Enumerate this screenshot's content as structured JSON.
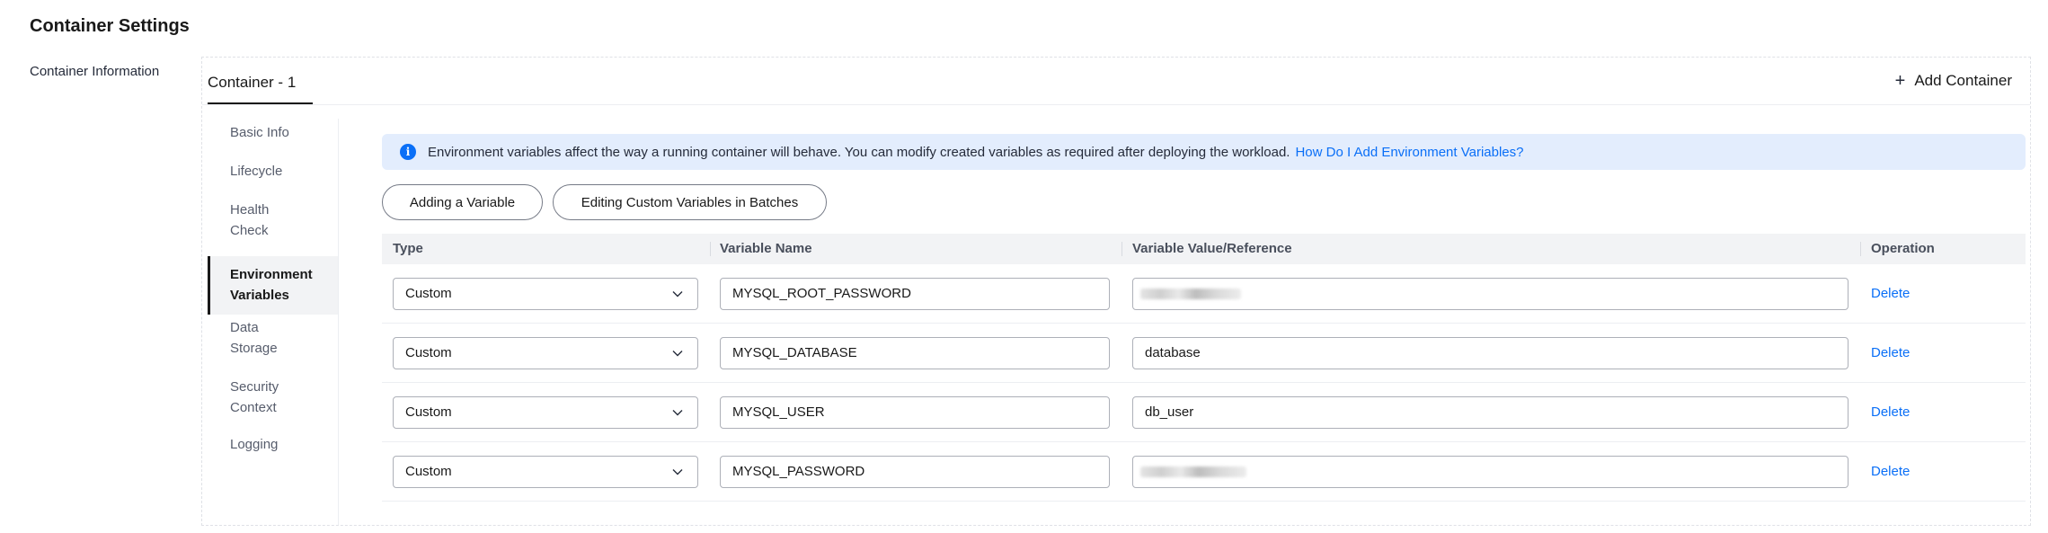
{
  "page": {
    "title": "Container Settings",
    "section_label": "Container Information"
  },
  "tabs": {
    "active_label": "Container - 1",
    "add_label": "Add Container",
    "add_icon": "plus-icon"
  },
  "side_nav": {
    "items": [
      {
        "label": "Basic Info"
      },
      {
        "label": "Lifecycle"
      },
      {
        "label": "Health Check"
      },
      {
        "label": "Environment Variables"
      },
      {
        "label": "Data Storage"
      },
      {
        "label": "Security Context"
      },
      {
        "label": "Logging"
      }
    ],
    "active_index": 3
  },
  "banner": {
    "icon": "info-icon",
    "text": "Environment variables affect the way a running container will behave. You can modify created variables as required after deploying the workload.",
    "link": "How Do I Add Environment Variables?"
  },
  "buttons": {
    "add_variable": "Adding a Variable",
    "edit_batch": "Editing Custom Variables in Batches"
  },
  "table": {
    "headers": {
      "type": "Type",
      "name": "Variable Name",
      "value": "Variable Value/Reference",
      "operation": "Operation"
    },
    "rows": [
      {
        "type": "Custom",
        "name": "MYSQL_ROOT_PASSWORD",
        "value": "",
        "masked": true,
        "operation": "Delete"
      },
      {
        "type": "Custom",
        "name": "MYSQL_DATABASE",
        "value": "database",
        "masked": false,
        "operation": "Delete"
      },
      {
        "type": "Custom",
        "name": "MYSQL_USER",
        "value": "db_user",
        "masked": false,
        "operation": "Delete"
      },
      {
        "type": "Custom",
        "name": "MYSQL_PASSWORD",
        "value": "",
        "masked": true,
        "operation": "Delete"
      }
    ]
  },
  "colors": {
    "accent": "#0a6ff7",
    "banner_bg": "#e3edfd",
    "header_bg": "#f2f3f5"
  }
}
